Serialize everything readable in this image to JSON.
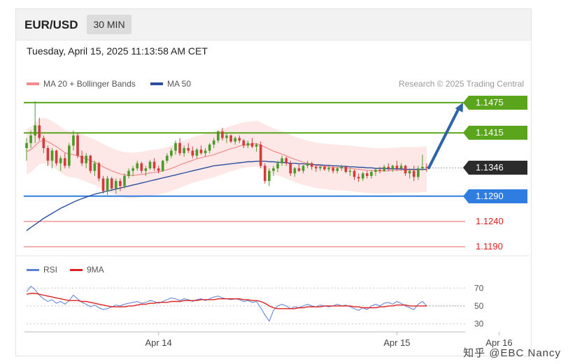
{
  "header": {
    "pair": "EUR/USD",
    "timeframe": "30 MIN"
  },
  "datetime": "Tuesday, April 15, 2025 11:13:58 AM CET",
  "legend": {
    "ma20": {
      "label": "MA 20 + Bollinger Bands",
      "color": "#f28b8b"
    },
    "ma50": {
      "label": "MA 50",
      "color": "#2b4f9e"
    }
  },
  "copyright": "Research © 2025 Trading Central",
  "rsi_legend": {
    "rsi": {
      "label": "RSI",
      "color": "#5b7fd6"
    },
    "ma9": {
      "label": "9MA",
      "color": "#e02020"
    }
  },
  "levels": [
    {
      "label": "1.1475",
      "value": 1.1475,
      "kind": "resistance",
      "color": "#5aa51c"
    },
    {
      "label": "1.1415",
      "value": 1.1415,
      "kind": "resistance",
      "color": "#5aa51c"
    },
    {
      "label": "1.1346",
      "value": 1.1346,
      "kind": "current",
      "color": "#2b2b2b"
    },
    {
      "label": "1.1290",
      "value": 1.129,
      "kind": "pivot",
      "color": "#2f7de1"
    },
    {
      "label": "1.1240",
      "value": 1.124,
      "kind": "support",
      "color": "#e02020"
    },
    {
      "label": "1.1190",
      "value": 1.119,
      "kind": "support",
      "color": "#e02020"
    }
  ],
  "watermark": "知乎 @EBC Nancy",
  "chart_data": [
    {
      "type": "candlestick",
      "ylim": [
        1.1175,
        1.149
      ],
      "xlabels": [
        "Apr 14",
        "Apr 15",
        "Apr 16"
      ],
      "xlabel_index": [
        31,
        87,
        111
      ],
      "candles": [
        [
          1.1385,
          1.1405,
          1.136,
          1.1395
        ],
        [
          1.1395,
          1.142,
          1.1385,
          1.141
        ],
        [
          1.141,
          1.1478,
          1.1395,
          1.143
        ],
        [
          1.143,
          1.1445,
          1.14,
          1.1405
        ],
        [
          1.1405,
          1.141,
          1.1375,
          1.1385
        ],
        [
          1.1385,
          1.139,
          1.135,
          1.136
        ],
        [
          1.136,
          1.1385,
          1.1345,
          1.138
        ],
        [
          1.138,
          1.1382,
          1.135,
          1.1355
        ],
        [
          1.1355,
          1.137,
          1.134,
          1.1365
        ],
        [
          1.1365,
          1.1375,
          1.1345,
          1.135
        ],
        [
          1.135,
          1.1395,
          1.1345,
          1.139
        ],
        [
          1.139,
          1.142,
          1.138,
          1.141
        ],
        [
          1.141,
          1.1415,
          1.1365,
          1.137
        ],
        [
          1.137,
          1.138,
          1.135,
          1.1355
        ],
        [
          1.1355,
          1.1375,
          1.1345,
          1.137
        ],
        [
          1.137,
          1.1372,
          1.1335,
          1.134
        ],
        [
          1.134,
          1.136,
          1.133,
          1.1355
        ],
        [
          1.1355,
          1.1358,
          1.132,
          1.1325
        ],
        [
          1.1325,
          1.133,
          1.1295,
          1.13
        ],
        [
          1.13,
          1.133,
          1.1292,
          1.1325
        ],
        [
          1.1325,
          1.1328,
          1.13,
          1.1305
        ],
        [
          1.1305,
          1.1325,
          1.1295,
          1.132
        ],
        [
          1.132,
          1.1325,
          1.13,
          1.131
        ],
        [
          1.131,
          1.1335,
          1.1305,
          1.133
        ],
        [
          1.133,
          1.1345,
          1.1325,
          1.134
        ],
        [
          1.134,
          1.135,
          1.133,
          1.1345
        ],
        [
          1.1345,
          1.136,
          1.134,
          1.1355
        ],
        [
          1.1355,
          1.1358,
          1.1335,
          1.134
        ],
        [
          1.134,
          1.135,
          1.133,
          1.1345
        ],
        [
          1.1345,
          1.1362,
          1.1342,
          1.1358
        ],
        [
          1.1358,
          1.1365,
          1.134,
          1.1345
        ],
        [
          1.1345,
          1.135,
          1.1335,
          1.134
        ],
        [
          1.134,
          1.1362,
          1.1338,
          1.136
        ],
        [
          1.136,
          1.1375,
          1.1355,
          1.137
        ],
        [
          1.137,
          1.1385,
          1.1365,
          1.138
        ],
        [
          1.138,
          1.14,
          1.1372,
          1.1395
        ],
        [
          1.1395,
          1.1405,
          1.137,
          1.1375
        ],
        [
          1.1375,
          1.139,
          1.1368,
          1.1385
        ],
        [
          1.1385,
          1.1395,
          1.1375,
          1.138
        ],
        [
          1.138,
          1.1388,
          1.1365,
          1.137
        ],
        [
          1.137,
          1.1385,
          1.1365,
          1.1382
        ],
        [
          1.1382,
          1.139,
          1.1372,
          1.1375
        ],
        [
          1.1375,
          1.1385,
          1.1368,
          1.138
        ],
        [
          1.138,
          1.1395,
          1.1375,
          1.1392
        ],
        [
          1.1392,
          1.1405,
          1.1385,
          1.14
        ],
        [
          1.14,
          1.142,
          1.1395,
          1.1418
        ],
        [
          1.1418,
          1.1425,
          1.14,
          1.1405
        ],
        [
          1.1405,
          1.1415,
          1.1395,
          1.141
        ],
        [
          1.141,
          1.1412,
          1.1395,
          1.1398
        ],
        [
          1.1398,
          1.1408,
          1.1392,
          1.1405
        ],
        [
          1.1405,
          1.141,
          1.1395,
          1.14
        ],
        [
          1.14,
          1.1403,
          1.1385,
          1.139
        ],
        [
          1.139,
          1.14,
          1.1385,
          1.1395
        ],
        [
          1.1395,
          1.1405,
          1.1385,
          1.1388
        ],
        [
          1.1388,
          1.1395,
          1.1378,
          1.1392
        ],
        [
          1.1392,
          1.1398,
          1.1345,
          1.135
        ],
        [
          1.135,
          1.1355,
          1.1315,
          1.132
        ],
        [
          1.132,
          1.1345,
          1.131,
          1.134
        ],
        [
          1.134,
          1.135,
          1.133,
          1.1345
        ],
        [
          1.1345,
          1.136,
          1.1338,
          1.1355
        ],
        [
          1.1355,
          1.137,
          1.135,
          1.1365
        ],
        [
          1.1365,
          1.1368,
          1.135,
          1.1355
        ],
        [
          1.1355,
          1.136,
          1.133,
          1.1335
        ],
        [
          1.1335,
          1.1348,
          1.1328,
          1.1345
        ],
        [
          1.1345,
          1.1355,
          1.1338,
          1.134
        ],
        [
          1.134,
          1.1352,
          1.1335,
          1.135
        ],
        [
          1.135,
          1.136,
          1.1345,
          1.1355
        ],
        [
          1.1355,
          1.1358,
          1.1342,
          1.1348
        ],
        [
          1.1348,
          1.1352,
          1.1338,
          1.1345
        ],
        [
          1.1345,
          1.135,
          1.134,
          1.1348
        ],
        [
          1.1348,
          1.1352,
          1.134,
          1.1343
        ],
        [
          1.1343,
          1.135,
          1.1338,
          1.1346
        ],
        [
          1.1346,
          1.135,
          1.1335,
          1.134
        ],
        [
          1.134,
          1.1348,
          1.1335,
          1.1345
        ],
        [
          1.1345,
          1.1352,
          1.134,
          1.1348
        ],
        [
          1.1348,
          1.135,
          1.1335,
          1.1338
        ],
        [
          1.1338,
          1.1345,
          1.133,
          1.134
        ],
        [
          1.134,
          1.1343,
          1.1322,
          1.1328
        ],
        [
          1.1328,
          1.1335,
          1.1318,
          1.1325
        ],
        [
          1.1325,
          1.1338,
          1.132,
          1.1335
        ],
        [
          1.1335,
          1.134,
          1.1325,
          1.133
        ],
        [
          1.133,
          1.1342,
          1.1325,
          1.1338
        ],
        [
          1.1338,
          1.1345,
          1.133,
          1.1342
        ],
        [
          1.1342,
          1.1348,
          1.1335,
          1.134
        ],
        [
          1.134,
          1.1352,
          1.1338,
          1.1348
        ],
        [
          1.1348,
          1.1355,
          1.134,
          1.1345
        ],
        [
          1.1345,
          1.1352,
          1.1338,
          1.135
        ],
        [
          1.135,
          1.136,
          1.134,
          1.1345
        ],
        [
          1.1345,
          1.1355,
          1.134,
          1.135
        ],
        [
          1.135,
          1.1352,
          1.133,
          1.1335
        ],
        [
          1.1335,
          1.1345,
          1.1325,
          1.134
        ],
        [
          1.134,
          1.135,
          1.132,
          1.1328
        ],
        [
          1.1328,
          1.135,
          1.1322,
          1.1345
        ],
        [
          1.1345,
          1.1372,
          1.134,
          1.1348
        ],
        [
          1.1348,
          1.1355,
          1.1338,
          1.1346
        ]
      ],
      "ma20": [
        1.1378,
        1.1382,
        1.139,
        1.1398,
        1.14,
        1.1398,
        1.1393,
        1.1388,
        1.1382,
        1.1376,
        1.1373,
        1.1372,
        1.137,
        1.1367,
        1.1364,
        1.136,
        1.1357,
        1.1353,
        1.1348,
        1.1344,
        1.134,
        1.1337,
        1.1334,
        1.1332,
        1.1331,
        1.1331,
        1.1332,
        1.1333,
        1.1334,
        1.1336,
        1.1337,
        1.1338,
        1.134,
        1.1342,
        1.1345,
        1.1348,
        1.1352,
        1.1355,
        1.1358,
        1.1361,
        1.1364,
        1.1366,
        1.1368,
        1.137,
        1.1372,
        1.1375,
        1.1378,
        1.1381,
        1.1384,
        1.1386,
        1.1389,
        1.1391,
        1.1392,
        1.1393,
        1.1394,
        1.1391,
        1.1387,
        1.1383,
        1.1379,
        1.1376,
        1.1373,
        1.137,
        1.1366,
        1.1363,
        1.136,
        1.1357,
        1.1355,
        1.1353,
        1.1351,
        1.135,
        1.1349,
        1.1348,
        1.1347,
        1.1347,
        1.1346,
        1.1346,
        1.1345,
        1.1344,
        1.1343,
        1.1342,
        1.1341,
        1.1341,
        1.134,
        1.134,
        1.134,
        1.134,
        1.1341,
        1.1341,
        1.1342,
        1.1342,
        1.1342,
        1.1342,
        1.1342,
        1.1343,
        1.1343
      ],
      "ma50": [
        1.1222,
        1.1228,
        1.1234,
        1.124,
        1.1246,
        1.1251,
        1.1256,
        1.1261,
        1.1266,
        1.127,
        1.1274,
        1.1278,
        1.1282,
        1.1285,
        1.1288,
        1.1291,
        1.1294,
        1.1296,
        1.1298,
        1.13,
        1.1302,
        1.1304,
        1.1306,
        1.1308,
        1.131,
        1.1312,
        1.1314,
        1.1316,
        1.1318,
        1.132,
        1.1322,
        1.1324,
        1.1326,
        1.1328,
        1.133,
        1.1332,
        1.1334,
        1.1336,
        1.1338,
        1.134,
        1.1342,
        1.1344,
        1.1346,
        1.1348,
        1.135,
        1.1351,
        1.1352,
        1.1353,
        1.1354,
        1.1355,
        1.1356,
        1.1357,
        1.1358,
        1.1358,
        1.1359,
        1.1359,
        1.1359,
        1.1358,
        1.1358,
        1.1357,
        1.1357,
        1.1356,
        1.1355,
        1.1355,
        1.1354,
        1.1354,
        1.1353,
        1.1353,
        1.1352,
        1.1352,
        1.1351,
        1.1351,
        1.135,
        1.135,
        1.1349,
        1.1349,
        1.1348,
        1.1348,
        1.1347,
        1.1347,
        1.1346,
        1.1346,
        1.1345,
        1.1345,
        1.1345,
        1.1344,
        1.1344,
        1.1344,
        1.1344,
        1.1343,
        1.1343,
        1.1343,
        1.1343,
        1.1343,
        1.1343
      ],
      "bb_width": 0.0045,
      "projection": {
        "from_value": 1.1346,
        "to_value": 1.1475
      }
    },
    {
      "type": "line",
      "name": "RSI",
      "ylim": [
        25,
        78
      ],
      "yticks": [
        70,
        50,
        30
      ],
      "series": [
        {
          "name": "RSI",
          "color": "#5b7fd6",
          "values": [
            66,
            72,
            68,
            62,
            58,
            55,
            57,
            53,
            55,
            52,
            56,
            62,
            58,
            54,
            52,
            49,
            51,
            48,
            46,
            47,
            49,
            51,
            50,
            52,
            53,
            54,
            55,
            53,
            54,
            56,
            55,
            53,
            55,
            57,
            59,
            58,
            56,
            58,
            57,
            55,
            57,
            58,
            56,
            58,
            60,
            61,
            59,
            58,
            57,
            58,
            57,
            55,
            56,
            54,
            55,
            48,
            40,
            33,
            45,
            50,
            52,
            50,
            47,
            49,
            48,
            50,
            52,
            50,
            49,
            51,
            50,
            49,
            50,
            52,
            50,
            51,
            49,
            47,
            45,
            48,
            46,
            50,
            52,
            50,
            53,
            54,
            52,
            55,
            53,
            50,
            48,
            46,
            52,
            55,
            50
          ]
        },
        {
          "name": "9MA",
          "color": "#e02020",
          "values": [
            63,
            64,
            64,
            63,
            62,
            61,
            60,
            59,
            58,
            57,
            56,
            56,
            56,
            55,
            55,
            54,
            53,
            52,
            51,
            50,
            49,
            49,
            49,
            49,
            50,
            50,
            51,
            52,
            52,
            53,
            53,
            54,
            54,
            54,
            55,
            55,
            55,
            56,
            56,
            56,
            56,
            57,
            57,
            57,
            57,
            58,
            58,
            58,
            58,
            58,
            58,
            57,
            57,
            56,
            56,
            55,
            53,
            50,
            48,
            47,
            47,
            47,
            47,
            47,
            48,
            48,
            49,
            49,
            49,
            49,
            50,
            50,
            50,
            50,
            50,
            50,
            50,
            49,
            49,
            48,
            48,
            48,
            48,
            49,
            49,
            50,
            50,
            51,
            51,
            51,
            50,
            50,
            50,
            50,
            50
          ]
        }
      ]
    }
  ]
}
